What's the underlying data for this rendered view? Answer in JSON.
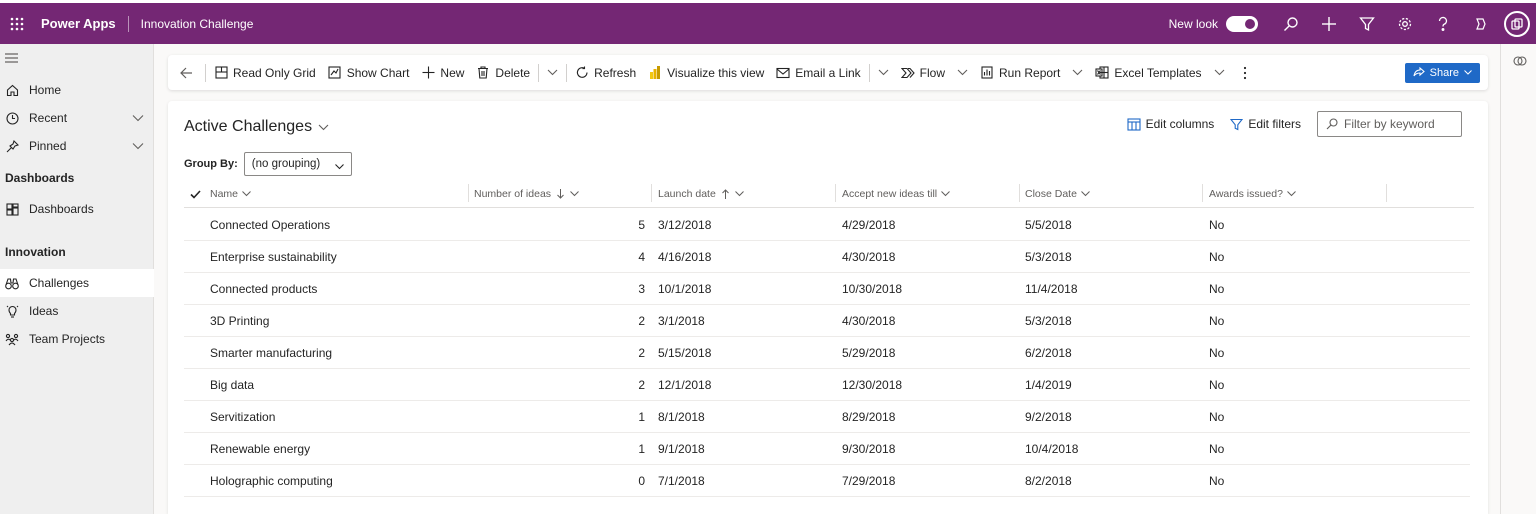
{
  "topbar": {
    "app_name": "Power Apps",
    "environment": "Innovation Challenge",
    "new_look_label": "New look",
    "new_look_enabled": true,
    "icons": [
      "waffle-icon",
      "search-icon",
      "add-icon",
      "filter-icon",
      "settings-icon",
      "help-icon",
      "copilot-icon",
      "account-icon"
    ],
    "background": "#742774"
  },
  "sidebar": {
    "items_top": [
      {
        "label": "Home",
        "icon": "home-icon"
      },
      {
        "label": "Recent",
        "icon": "clock-icon",
        "expandable": true
      },
      {
        "label": "Pinned",
        "icon": "pin-icon",
        "expandable": true
      }
    ],
    "group_dashboards": "Dashboards",
    "dashboards_item": {
      "label": "Dashboards",
      "icon": "dashboard-icon"
    },
    "group_innovation": "Innovation",
    "innovation_items": [
      {
        "label": "Challenges",
        "icon": "binoculars-icon",
        "selected": true
      },
      {
        "label": "Ideas",
        "icon": "lightbulb-icon"
      },
      {
        "label": "Team Projects",
        "icon": "team-icon"
      }
    ]
  },
  "commandbar": {
    "read_only_grid": "Read Only Grid",
    "show_chart": "Show Chart",
    "new": "New",
    "delete": "Delete",
    "refresh": "Refresh",
    "visualize": "Visualize this view",
    "email_link": "Email a Link",
    "flow": "Flow",
    "run_report": "Run Report",
    "excel_templates": "Excel Templates",
    "share": "Share",
    "accent": "#1f69c7"
  },
  "view": {
    "title": "Active Challenges",
    "edit_columns": "Edit columns",
    "edit_filters": "Edit filters",
    "filter_placeholder": "Filter by keyword",
    "group_by_label": "Group By:",
    "group_by_value": "(no grouping)"
  },
  "grid": {
    "columns": [
      {
        "label": "Name",
        "sort": ""
      },
      {
        "label": "Number of ideas",
        "sort": "desc"
      },
      {
        "label": "Launch date",
        "sort": "asc"
      },
      {
        "label": "Accept new ideas till",
        "sort": ""
      },
      {
        "label": "Close Date",
        "sort": ""
      },
      {
        "label": "Awards issued?",
        "sort": ""
      }
    ],
    "rows": [
      {
        "name": "Connected Operations",
        "ideas": "5",
        "launch": "3/12/2018",
        "accept": "4/29/2018",
        "close": "5/5/2018",
        "awards": "No"
      },
      {
        "name": "Enterprise sustainability",
        "ideas": "4",
        "launch": "4/16/2018",
        "accept": "4/30/2018",
        "close": "5/3/2018",
        "awards": "No"
      },
      {
        "name": "Connected products",
        "ideas": "3",
        "launch": "10/1/2018",
        "accept": "10/30/2018",
        "close": "11/4/2018",
        "awards": "No"
      },
      {
        "name": "3D Printing",
        "ideas": "2",
        "launch": "3/1/2018",
        "accept": "4/30/2018",
        "close": "5/3/2018",
        "awards": "No"
      },
      {
        "name": "Smarter manufacturing",
        "ideas": "2",
        "launch": "5/15/2018",
        "accept": "5/29/2018",
        "close": "6/2/2018",
        "awards": "No"
      },
      {
        "name": "Big data",
        "ideas": "2",
        "launch": "12/1/2018",
        "accept": "12/30/2018",
        "close": "1/4/2019",
        "awards": "No"
      },
      {
        "name": "Servitization",
        "ideas": "1",
        "launch": "8/1/2018",
        "accept": "8/29/2018",
        "close": "9/2/2018",
        "awards": "No"
      },
      {
        "name": "Renewable energy",
        "ideas": "1",
        "launch": "9/1/2018",
        "accept": "9/30/2018",
        "close": "10/4/2018",
        "awards": "No"
      },
      {
        "name": "Holographic computing",
        "ideas": "0",
        "launch": "7/1/2018",
        "accept": "7/29/2018",
        "close": "8/2/2018",
        "awards": "No"
      }
    ]
  }
}
